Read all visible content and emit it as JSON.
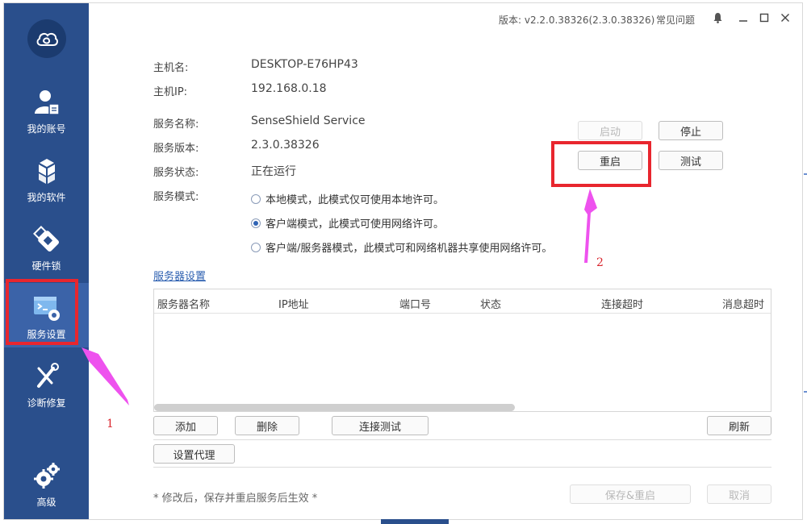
{
  "titlebar": {
    "version": "版本: v2.2.0.38326(2.3.0.38326)",
    "faq": "常见问题",
    "icons": [
      "bell-icon",
      "minimize-icon",
      "maximize-icon",
      "close-icon"
    ]
  },
  "sidebar": {
    "logo": "cloud-logo-icon",
    "items": [
      {
        "label": "我的账号",
        "icon": "user-account-icon"
      },
      {
        "label": "我的软件",
        "icon": "cubes-icon"
      },
      {
        "label": "硬件锁",
        "icon": "usb-dongle-icon"
      },
      {
        "label": "服务设置",
        "icon": "service-settings-icon",
        "active": true
      },
      {
        "label": "诊断修复",
        "icon": "repair-tools-icon"
      },
      {
        "label": "高级",
        "icon": "gears-icon"
      }
    ]
  },
  "info": {
    "host_name_label": "主机名:",
    "host_name": "DESKTOP-E76HP43",
    "host_ip_label": "主机IP:",
    "host_ip": "192.168.0.18",
    "service_name_label": "服务名称:",
    "service_name": "SenseShield Service",
    "service_version_label": "服务版本:",
    "service_version": "2.3.0.38326",
    "service_status_label": "服务状态:",
    "service_status": "正在运行",
    "service_mode_label": "服务模式:"
  },
  "modes": [
    {
      "label": "本地模式，此模式仅可使用本地许可。",
      "selected": false
    },
    {
      "label": "客户端模式，此模式可使用网络许可。",
      "selected": true
    },
    {
      "label": "客户端/服务器模式，此模式可和网络机器共享使用网络许可。",
      "selected": false
    }
  ],
  "service_buttons": {
    "start": "启动",
    "stop": "停止",
    "restart": "重启",
    "test": "测试"
  },
  "server_settings": {
    "link": "服务器设置",
    "columns": [
      "服务器名称",
      "IP地址",
      "端口号",
      "状态",
      "连接超时",
      "消息超时"
    ],
    "rows": []
  },
  "table_buttons": {
    "add": "添加",
    "delete": "删除",
    "connect_test": "连接测试",
    "refresh": "刷新",
    "proxy": "设置代理"
  },
  "footer": {
    "note": "* 修改后，保存并重启服务后生效 *",
    "save_restart": "保存&重启",
    "cancel": "取消"
  },
  "annotations": {
    "label_1": "1",
    "label_2": "2",
    "color": "#e8262e",
    "arrow_color": "#ee52ee"
  },
  "colors": {
    "sidebar": "#2a4f8c",
    "sidebar_active": "#3b63a8",
    "link": "#2c5fb0"
  }
}
